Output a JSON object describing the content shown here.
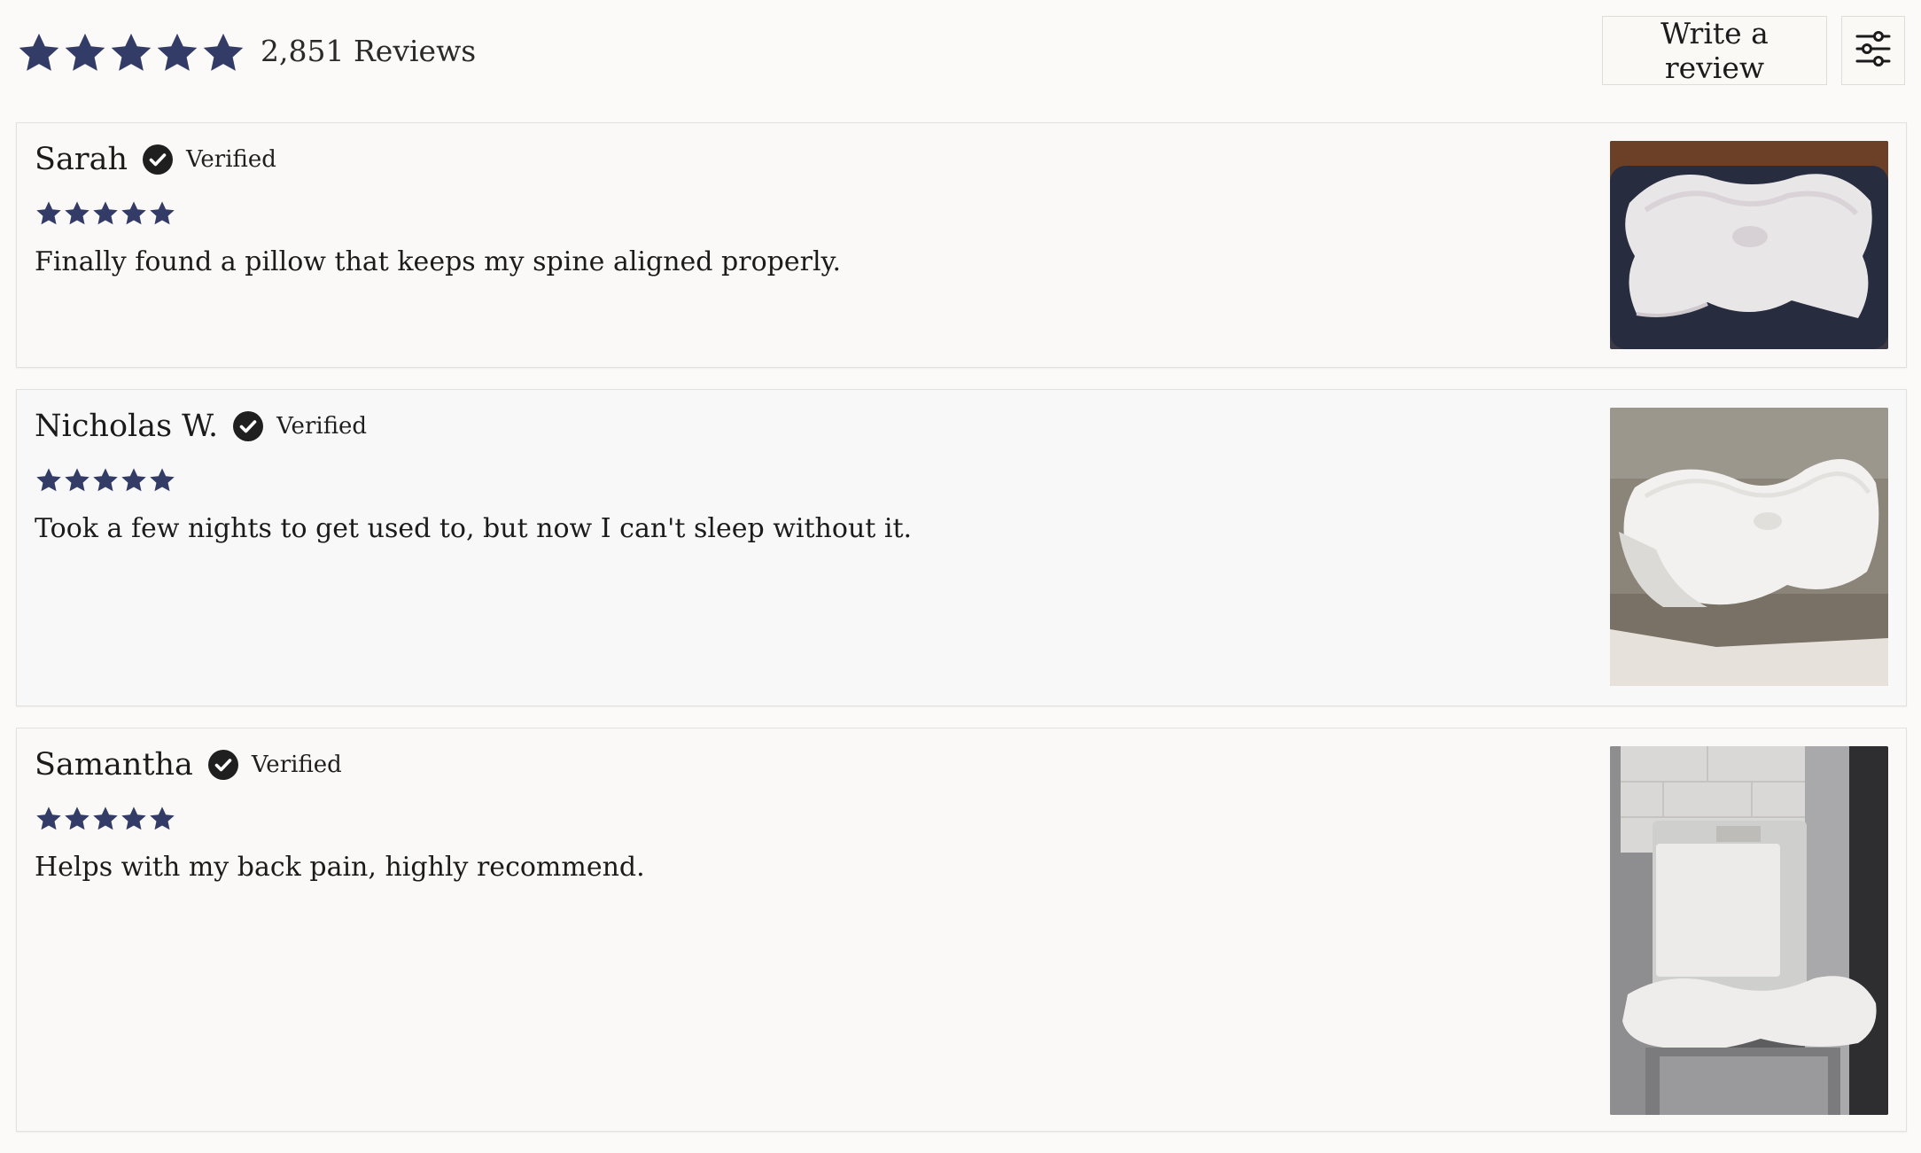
{
  "summary": {
    "rating_value": 5,
    "rating_max": 5,
    "reviews_count_label": "2,851 Reviews"
  },
  "actions": {
    "write_review_label": "Write a review",
    "filter_icon": "sliders-icon"
  },
  "colors": {
    "star_color": "#323c66",
    "page_background": "#fcfaf8",
    "card_alt_background": "#f8f8f8",
    "verified_badge": "#1f1f1f"
  },
  "reviews": [
    {
      "name": "Sarah",
      "verified_label": "Verified",
      "rating": 5,
      "body": "Finally found a pillow that keeps my spine aligned properly.",
      "photo": "contour-pillow-on-dark-sofa"
    },
    {
      "name": "Nicholas W.",
      "verified_label": "Verified",
      "rating": 5,
      "body": "Took a few nights to get used to, but now I can't sleep without it.",
      "photo": "contour-pillow-on-gray-couch"
    },
    {
      "name": "Samantha",
      "verified_label": "Verified",
      "rating": 5,
      "body": "Helps with my back pain, highly recommend.",
      "photo": "packaged-pillow-on-cabinet"
    }
  ]
}
